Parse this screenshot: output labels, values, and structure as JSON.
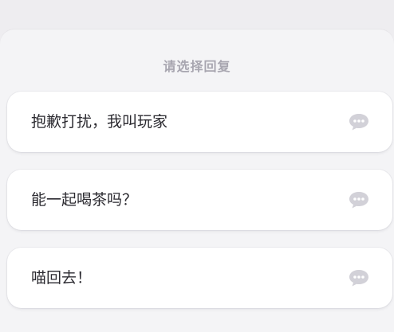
{
  "dialog": {
    "title": "请选择回复",
    "options": [
      {
        "label": "抱歉打扰，我叫玩家",
        "icon": "speech-bubble-icon"
      },
      {
        "label": "能一起喝茶吗？",
        "icon": "speech-bubble-icon"
      },
      {
        "label": "喵回去！",
        "icon": "speech-bubble-icon"
      }
    ]
  },
  "colors": {
    "page_background": "#eeedf0",
    "sheet_background": "#f4f4f6",
    "card_background": "#ffffff",
    "title_text": "#a8a6b0",
    "option_text": "#2b2a30",
    "icon": "#d2d1d8"
  }
}
